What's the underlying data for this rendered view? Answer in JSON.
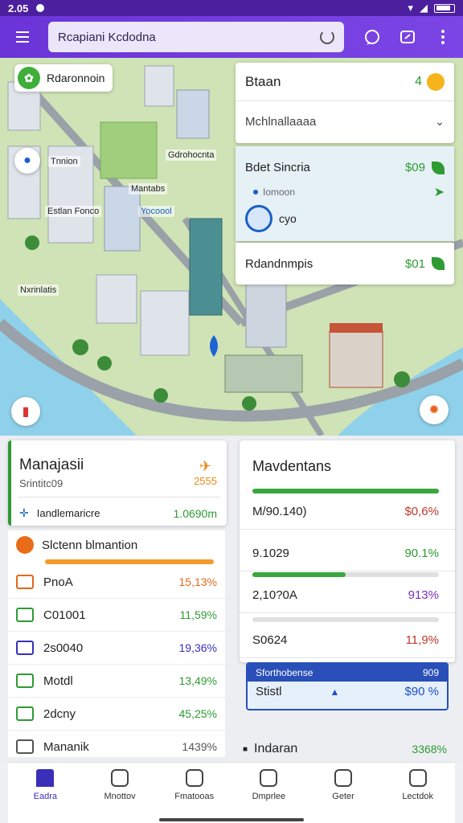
{
  "status": {
    "time": "2.05"
  },
  "appbar": {
    "search_value": "Rcapiani Kcdodna",
    "icons": [
      "menu-icon",
      "refresh-icon",
      "chat-icon",
      "share-icon",
      "more-vert-icon"
    ]
  },
  "map": {
    "chip_label": "Rdaronnoin",
    "labels": [
      "Gdrohocnta",
      "Tnnion",
      "Mantabs",
      "Estlan Fonco",
      "Yocoool",
      "Nxrinlatis"
    ],
    "top_card": {
      "title": "Btaan",
      "count": "4",
      "dropdown": "Mchlnallaaaa"
    },
    "mid_card": {
      "title": "Bdet Sincria",
      "value": "$09",
      "sub": "Iomoon",
      "gear_label": "cyo"
    },
    "bot_card": {
      "title": "Rdandnmpis",
      "value": "$01"
    }
  },
  "left_card": {
    "title": "Manajasii",
    "subtitle": "Srintitc09",
    "badge": "2555",
    "row_label": "Iandlemaricre",
    "row_value": "1.0690m"
  },
  "list": {
    "header": "Slctenn blmantion",
    "items": [
      {
        "label": "PnoA",
        "value": "15,13%",
        "color": "#e06a1a"
      },
      {
        "label": "C01001",
        "value": "11,59%",
        "color": "#2e9b33"
      },
      {
        "label": "2s0040",
        "value": "19,36%",
        "color": "#3a2fb8"
      },
      {
        "label": "Motdl",
        "value": "13,49%",
        "color": "#2e9b33"
      },
      {
        "label": "2dcny",
        "value": "45,25%",
        "color": "#2e9b33"
      },
      {
        "label": "Mananik",
        "value": "1439%",
        "color": "#555555"
      }
    ]
  },
  "right_card": {
    "title": "Mavdentans",
    "rows": [
      {
        "label": "M/90.140)",
        "value": "$0,6%",
        "color": "#c0392b",
        "progress": 1.0
      },
      {
        "label": "9.1029",
        "value": "90.1%",
        "color": "#2e9b33",
        "progress": null
      },
      {
        "label": "2,10?0A",
        "value": "913%",
        "color": "#7a2fb8",
        "progress": 0.5
      },
      {
        "label": "S0624",
        "value": "11,9%",
        "color": "#c0392b",
        "progress": 0.0
      }
    ]
  },
  "blue_box": {
    "header": "Sforthobense",
    "header_right": "909",
    "label": "Stistl",
    "value": "$90 %"
  },
  "bottom_row": {
    "label": "Indaran",
    "value": "3368%"
  },
  "nav": {
    "items": [
      {
        "label": "Eadra",
        "active": true
      },
      {
        "label": "Mnottov",
        "active": false
      },
      {
        "label": "Fmatooas",
        "active": false
      },
      {
        "label": "Dmprlee",
        "active": false
      },
      {
        "label": "Geter",
        "active": false
      },
      {
        "label": "Lectdok",
        "active": false
      }
    ]
  }
}
